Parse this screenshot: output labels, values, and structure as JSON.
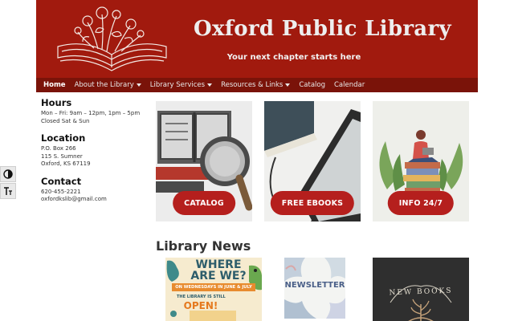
{
  "header": {
    "site_title": "Oxford Public Library",
    "tagline": "Your next chapter starts here",
    "background_color": "#a11a0e"
  },
  "nav": {
    "items": [
      {
        "label": "Home",
        "active": true,
        "has_dropdown": false
      },
      {
        "label": "About the Library",
        "active": false,
        "has_dropdown": true
      },
      {
        "label": "Library Services",
        "active": false,
        "has_dropdown": true
      },
      {
        "label": "Resources & Links",
        "active": false,
        "has_dropdown": true
      },
      {
        "label": "Catalog",
        "active": false,
        "has_dropdown": false
      },
      {
        "label": "Calendar",
        "active": false,
        "has_dropdown": false
      }
    ]
  },
  "sidebar": {
    "hours": {
      "heading": "Hours",
      "lines": [
        "Mon – Fri: 9am – 12pm, 1pm – 5pm",
        "Closed Sat & Sun"
      ]
    },
    "location": {
      "heading": "Location",
      "lines": [
        "P.O. Box 266",
        "115 S. Sumner",
        "Oxford, KS 67119"
      ]
    },
    "contact": {
      "heading": "Contact",
      "lines": [
        "620-455-2221",
        "oxfordkslib@gmail.com"
      ]
    }
  },
  "accessibility": {
    "contrast_icon": "contrast-icon",
    "text_size_icon": "text-size-icon"
  },
  "cards": [
    {
      "button": "CATALOG",
      "icon": "book-magnifier"
    },
    {
      "button": "FREE EBOOKS",
      "icon": "tablet-ereader"
    },
    {
      "button": "INFO 24/7",
      "icon": "person-on-books"
    }
  ],
  "news": {
    "heading": "Library News",
    "items": [
      {
        "title_line1": "WHERE",
        "title_line2": "ARE WE?",
        "banner": "ON WEDNESDAYS IN JUNE & JULY",
        "sub": "THE LIBRARY IS STILL",
        "status": "OPEN!"
      },
      {
        "title": "NEWSLETTER"
      },
      {
        "title": "NEW BOOKS"
      }
    ]
  },
  "colors": {
    "accent_red": "#b51f1d",
    "nav_dark_red": "#7a1309"
  }
}
